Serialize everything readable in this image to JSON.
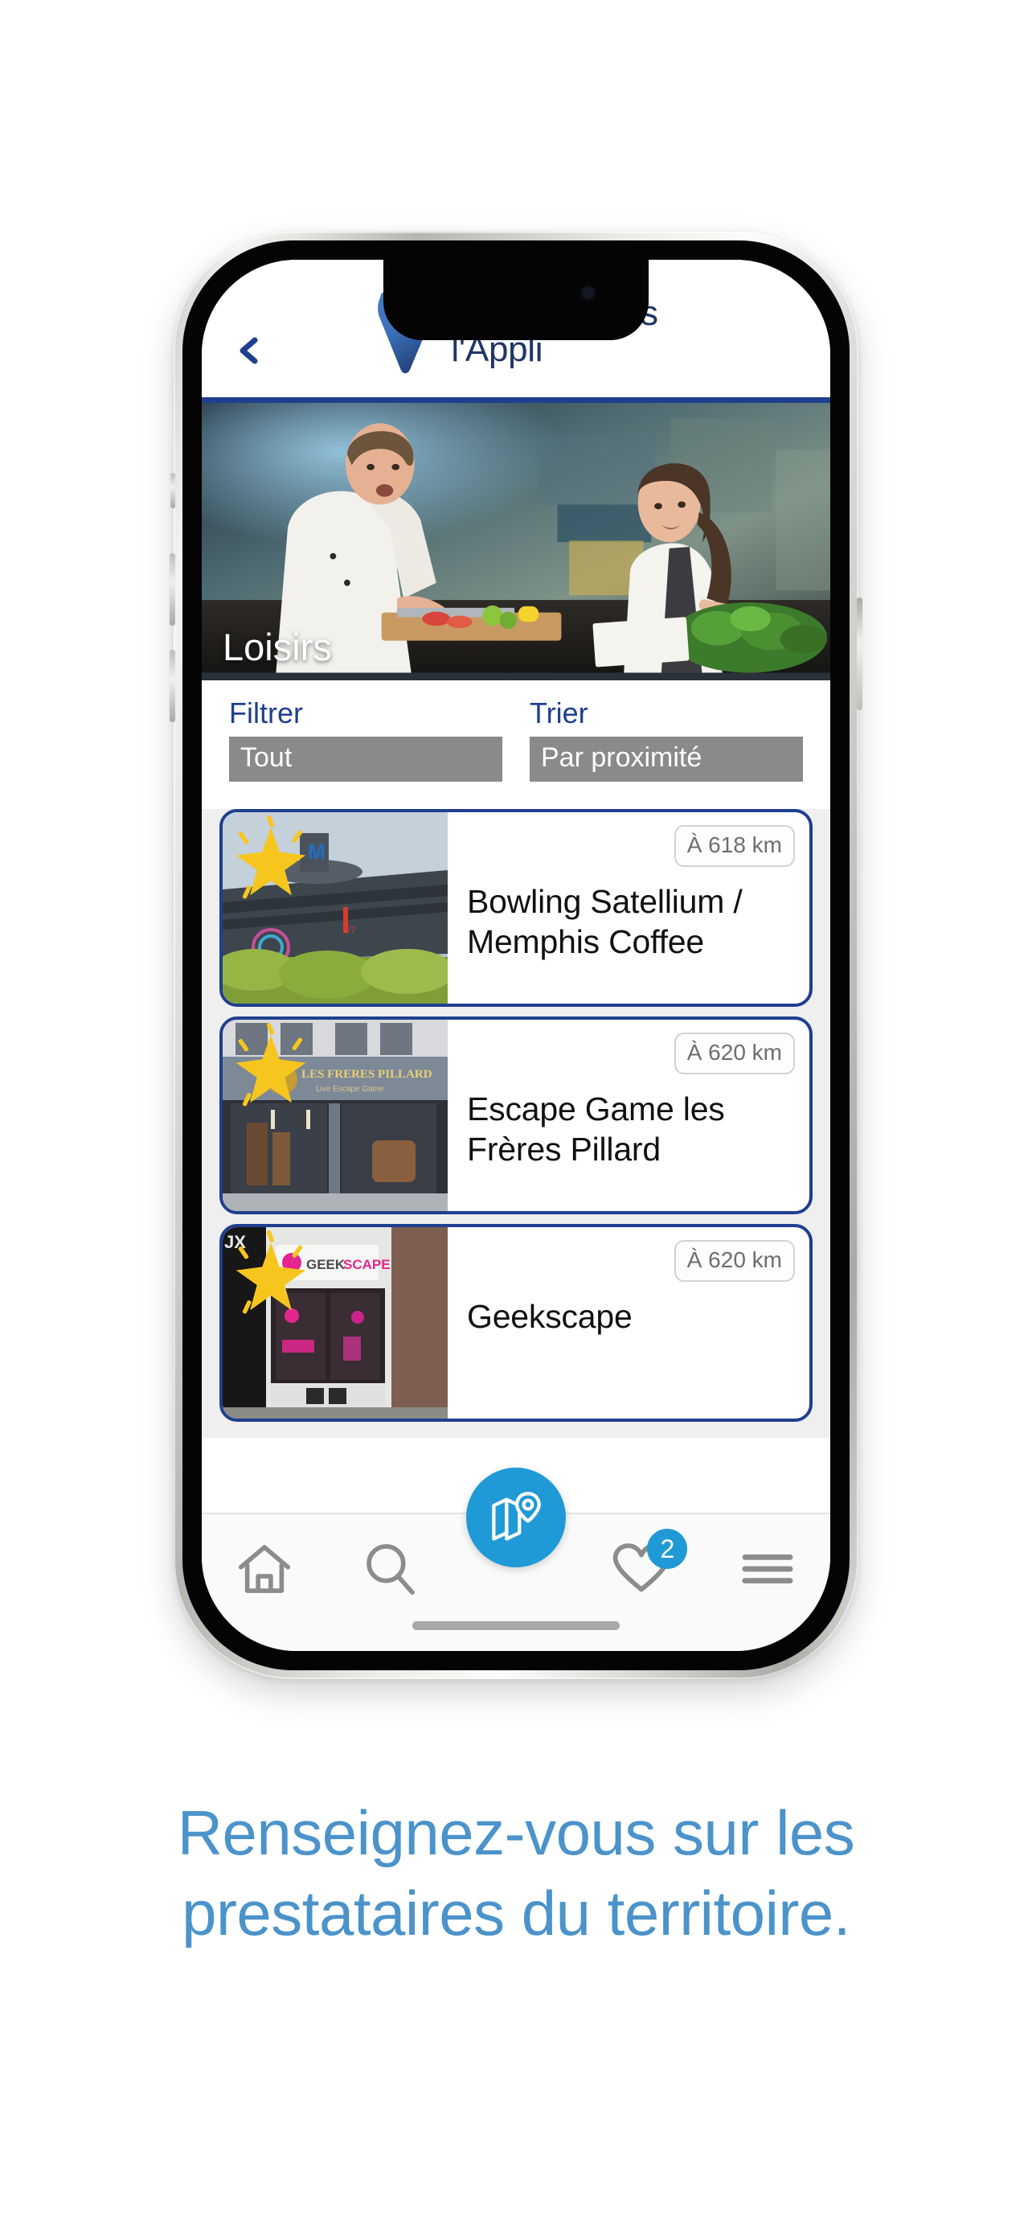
{
  "header": {
    "back_icon": "chevron-left-icon",
    "logo_icon": "valenciennes-v-logo",
    "brand_line1": "Valenciennes",
    "brand_line2": "l'Appli"
  },
  "hero": {
    "title": "Loisirs",
    "image_alt": "chef-and-woman-in-kitchen"
  },
  "filters": {
    "filter_label": "Filtrer",
    "filter_value": "Tout",
    "sort_label": "Trier",
    "sort_value": "Par proximité"
  },
  "list": [
    {
      "title": "Bowling Satellium / Memphis Coffee",
      "distance": "À 618 km",
      "badge_icon": "star-sparkle-icon",
      "thumb_alt": "bowling-satellium-building"
    },
    {
      "title": "Escape Game les Frères Pillard",
      "distance": "À 620 km",
      "badge_icon": "star-sparkle-icon",
      "thumb_alt": "les-freres-pillard-storefront"
    },
    {
      "title": "Geekscape",
      "distance": "À 620 km",
      "badge_icon": "star-sparkle-icon",
      "thumb_alt": "geekscape-storefront"
    }
  ],
  "bottom_nav": {
    "home_icon": "home-icon",
    "search_icon": "search-icon",
    "map_icon": "map-pin-icon",
    "favorites_icon": "heart-icon",
    "favorites_count": "2",
    "menu_icon": "hamburger-menu-icon"
  },
  "tagline": {
    "line1": "Renseignez-vous sur les",
    "line2": "prestataires du territoire."
  },
  "colors": {
    "brand_navy": "#1f3f8f",
    "brand_blue": "#3a6eb5",
    "accent_cyan": "#1f9ad6",
    "tagline_blue": "#4b93ca",
    "select_gray": "#8a8a8a",
    "star_yellow": "#f7c61e"
  }
}
